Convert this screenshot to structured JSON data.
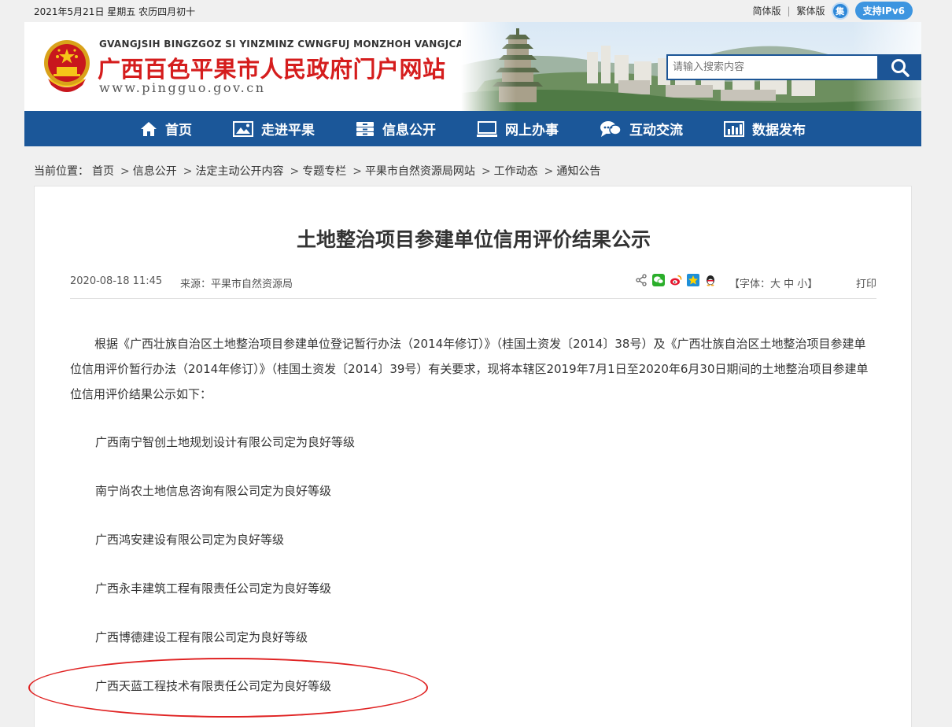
{
  "topbar": {
    "date": "2021年5月21日  星期五  农历四月初十",
    "simplified": "简体版",
    "separator": "|",
    "traditional": "繁体版",
    "ji_icon": "集",
    "ipv6": "支持IPv6"
  },
  "header": {
    "pinyin": "GVANGJSIH  BINGZGOZ SI  YINZMINZ CWNGFUJ MONZHOH  VANGJCAN",
    "title": "广西百色平果市人民政府门户网站",
    "url": "www.pingguo.gov.cn",
    "emblem_icon": "national-emblem-icon",
    "search_placeholder": "请输入搜索内容"
  },
  "nav": {
    "items": [
      {
        "label": "首页",
        "icon": "home-icon"
      },
      {
        "label": "走进平果",
        "icon": "picture-icon"
      },
      {
        "label": "信息公开",
        "icon": "cabinet-icon"
      },
      {
        "label": "网上办事",
        "icon": "monitor-icon"
      },
      {
        "label": "互动交流",
        "icon": "chat-icon"
      },
      {
        "label": "数据发布",
        "icon": "bar-chart-icon"
      }
    ]
  },
  "breadcrumb": {
    "prefix": "当前位置：",
    "items": [
      "首页",
      "信息公开",
      "法定主动公开内容",
      "专题专栏",
      "平果市自然资源局网站",
      "工作动态",
      "通知公告"
    ],
    "arrow": ">"
  },
  "article": {
    "title": "土地整治项目参建单位信用评价结果公示",
    "date": "2020-08-18 11:45",
    "source": "来源：平果市自然资源局",
    "font_size_label": "【字体：大 中 小】",
    "print": "打印",
    "paragraph": "根据《广西壮族自治区土地整治项目参建单位登记暂行办法（2014年修订）》（桂国土资发〔2014〕38号）及《广西壮族自治区土地整治项目参建单位信用评价暂行办法（2014年修订）》（桂国土资发〔2014〕39号）有关要求，现将本辖区2019年7月1日至2020年6月30日期间的土地整治项目参建单位信用评价结果公示如下：",
    "items": [
      "广西南宁智创土地规划设计有限公司定为良好等级",
      "南宁尚农土地信息咨询有限公司定为良好等级",
      "广西鸿安建设有限公司定为良好等级",
      "广西永丰建筑工程有限责任公司定为良好等级",
      "广西博德建设工程有限公司定为良好等级",
      "广西天蓝工程技术有限责任公司定为良好等级"
    ]
  },
  "colors": {
    "nav_bg": "#1b5799",
    "title_red": "#d51d1d",
    "annotation_red": "#e02424"
  }
}
